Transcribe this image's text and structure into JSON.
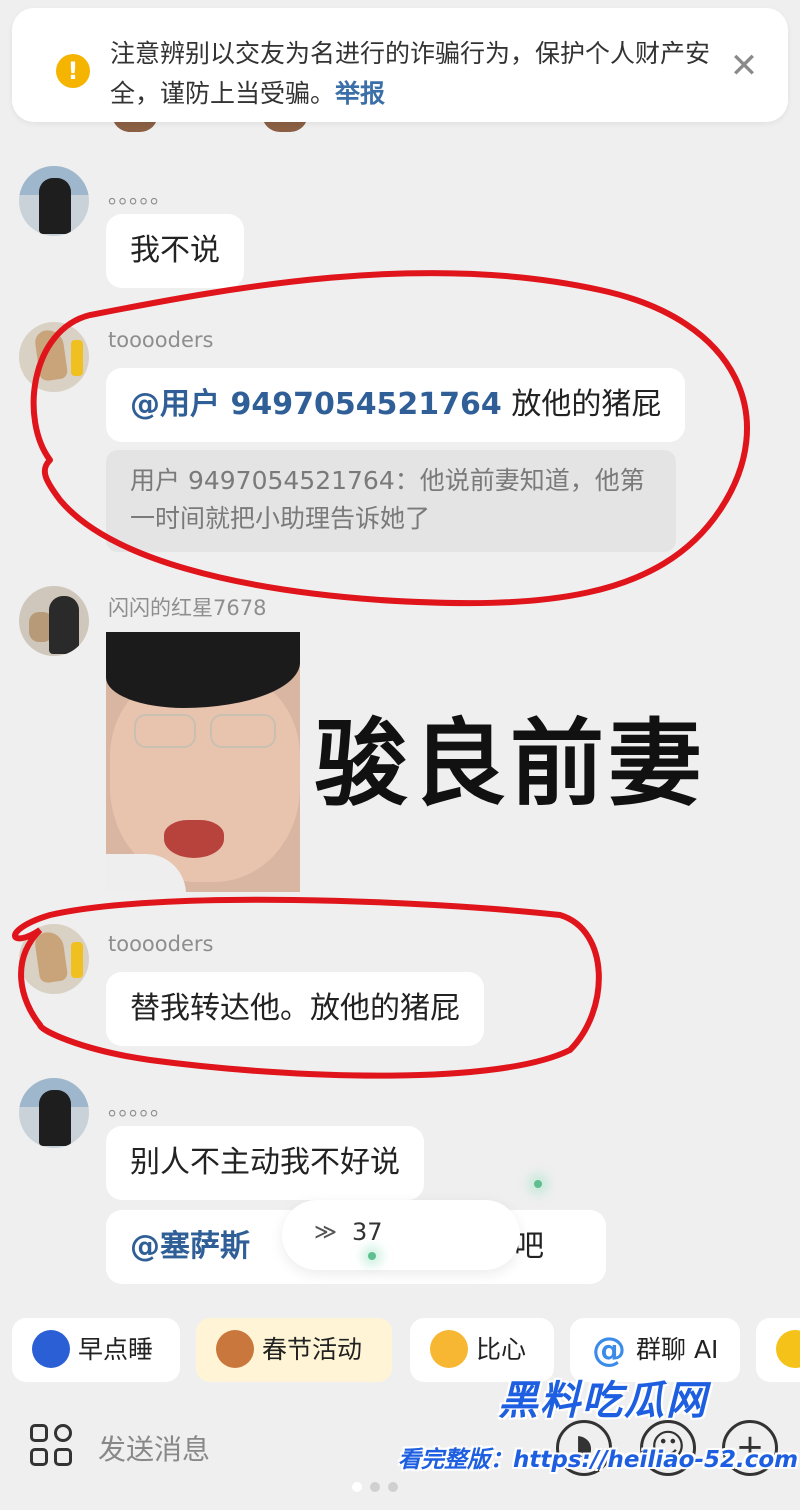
{
  "warning": {
    "text": "注意辨别以交友为名进行的诈骗行为，保护个人财产安全，谨防上当受骗。",
    "report_label": "举报",
    "close_symbol": "✕"
  },
  "messages": [
    {
      "sender": "。。。。。",
      "text": "我不说"
    },
    {
      "sender": "tooooders",
      "mention": "@用户 9497054521764",
      "text": " 放他的猪屁",
      "quote": "用户 9497054521764：他说前妻知道，他第一时间就把小助理告诉她了"
    },
    {
      "sender": "闪闪的红星7678",
      "image_caption": "骏良前妻"
    },
    {
      "sender": "tooooders",
      "text": "替我转达他。放他的猪屁"
    },
    {
      "sender": "。。。。。",
      "text": "别人不主动我不好说"
    },
    {
      "mention": "@塞萨斯",
      "text_tail": "吧"
    }
  ],
  "new_message_pill": {
    "count": "37",
    "icon": "double-chevron-down-icon"
  },
  "quick_actions": [
    {
      "label": "早点睡",
      "icon": "moon-icon"
    },
    {
      "label": "春节活动",
      "icon": "bear-icon"
    },
    {
      "label": "比心",
      "icon": "heart-hands-icon"
    },
    {
      "label": "群聊 AI",
      "icon": "at-icon"
    }
  ],
  "input": {
    "placeholder": "发送消息"
  },
  "watermark": {
    "logo": "黑料吃瓜网",
    "url": "看完整版：https://heiliao-52.com"
  },
  "colors": {
    "mention": "#2f5f96",
    "annotation": "#e0141b",
    "warning_icon": "#f5b400",
    "watermark": "#1d5fe0"
  }
}
